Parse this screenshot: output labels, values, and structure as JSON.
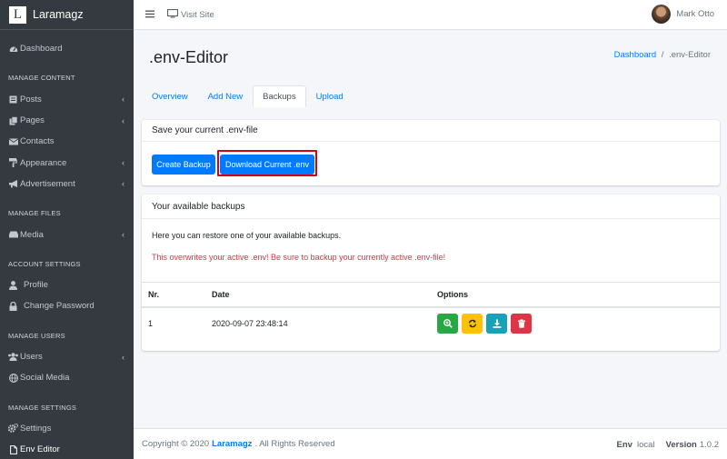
{
  "brand": {
    "logo_letter": "L",
    "name": "Laramagz"
  },
  "sidebar": {
    "dashboard": "Dashboard",
    "sections": {
      "content": "MANAGE CONTENT",
      "files": "MANAGE FILES",
      "account": "ACCOUNT SETTINGS",
      "users": "MANAGE USERS",
      "settings": "MANAGE SETTINGS"
    },
    "items": {
      "posts": "Posts",
      "pages": "Pages",
      "contacts": "Contacts",
      "appearance": "Appearance",
      "advertisement": "Advertisement",
      "media": "Media",
      "profile": "Profile",
      "change_password": "Change Password",
      "users": "Users",
      "social_media": "Social Media",
      "settings": "Settings",
      "env_editor": "Env Editor"
    }
  },
  "topbar": {
    "visit_site": "Visit Site",
    "user_name": "Mark Otto"
  },
  "page": {
    "title": ".env-Editor",
    "breadcrumb_home": "Dashboard",
    "breadcrumb_sep": "/",
    "breadcrumb_current": ".env-Editor"
  },
  "tabs": [
    "Overview",
    "Add New",
    "Backups",
    "Upload"
  ],
  "save_card": {
    "header": "Save your current .env-file",
    "create_button": "Create Backup",
    "download_button": "Download Current .env"
  },
  "backups_card": {
    "header": "Your available backups",
    "info": "Here you can restore one of your available backups.",
    "warning": "This overwrites your active .env! Be sure to backup your currently active .env-file!",
    "columns": [
      "Nr.",
      "Date",
      "Options"
    ],
    "rows": [
      {
        "nr": "1",
        "date": "2020-09-07 23:48:14"
      }
    ]
  },
  "footer": {
    "copyright_prefix": "Copyright © 2020",
    "brand": "Laramagz",
    "suffix": ". All Rights Reserved",
    "env_label": "Env",
    "env_value": "local",
    "version_label": "Version",
    "version_value": "1.0.2"
  },
  "colors": {
    "sidebar_bg": "#343a40",
    "primary": "#007bff",
    "danger": "#dc3545",
    "success": "#28a745",
    "warning": "#ffc107",
    "info": "#17a2b8"
  }
}
